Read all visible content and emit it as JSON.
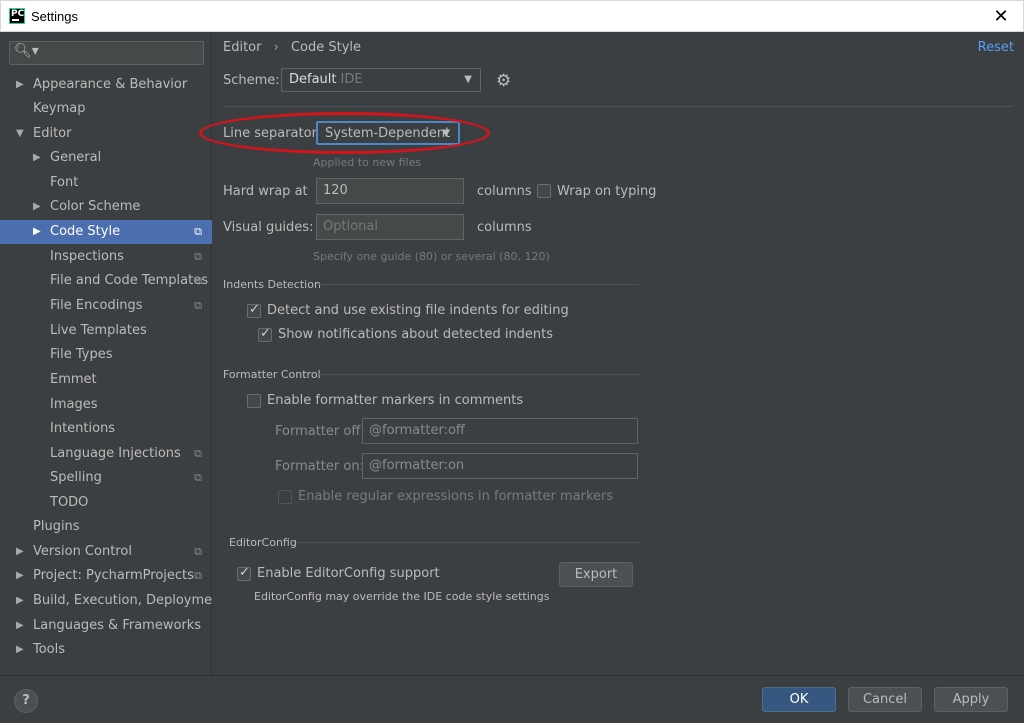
{
  "window": {
    "title": "Settings",
    "close_icon": "✕"
  },
  "sidebar": {
    "search_placeholder": "",
    "items": [
      {
        "label": "Appearance & Behavior"
      },
      {
        "label": "Keymap"
      },
      {
        "label": "Editor"
      },
      {
        "label": "General"
      },
      {
        "label": "Font"
      },
      {
        "label": "Color Scheme"
      },
      {
        "label": "Code Style"
      },
      {
        "label": "Inspections"
      },
      {
        "label": "File and Code Templates"
      },
      {
        "label": "File Encodings"
      },
      {
        "label": "Live Templates"
      },
      {
        "label": "File Types"
      },
      {
        "label": "Emmet"
      },
      {
        "label": "Images"
      },
      {
        "label": "Intentions"
      },
      {
        "label": "Language Injections"
      },
      {
        "label": "Spelling"
      },
      {
        "label": "TODO"
      },
      {
        "label": "Plugins"
      },
      {
        "label": "Version Control"
      },
      {
        "label": "Project: PycharmProjects"
      },
      {
        "label": "Build, Execution, Deployment"
      },
      {
        "label": "Languages & Frameworks"
      },
      {
        "label": "Tools"
      }
    ]
  },
  "header": {
    "breadcrumb_parent": "Editor",
    "breadcrumb_sep": "›",
    "breadcrumb_current": "Code Style",
    "reset": "Reset"
  },
  "scheme": {
    "label": "Scheme:",
    "value": "Default",
    "value_suffix": "IDE"
  },
  "line_separator": {
    "label": "Line separator:",
    "value": "System-Dependent",
    "hint": "Applied to new files"
  },
  "hard_wrap": {
    "label": "Hard wrap at",
    "value": "120",
    "unit": "columns",
    "wrap_on_typing": "Wrap on typing"
  },
  "visual_guides": {
    "label": "Visual guides:",
    "placeholder": "Optional",
    "unit": "columns",
    "hint": "Specify one guide (80) or several (80, 120)"
  },
  "indents": {
    "title": "Indents Detection",
    "detect": "Detect and use existing file indents for editing",
    "notify": "Show notifications about detected indents"
  },
  "formatter": {
    "title": "Formatter Control",
    "enable": "Enable formatter markers in comments",
    "off_label": "Formatter off:",
    "off_value": "@formatter:off",
    "on_label": "Formatter on:",
    "on_value": "@formatter:on",
    "regex": "Enable regular expressions in formatter markers"
  },
  "editorconfig": {
    "title": "EditorConfig",
    "enable": "Enable EditorConfig support",
    "export": "Export",
    "note": "EditorConfig may override the IDE code style settings"
  },
  "footer": {
    "help": "?",
    "ok": "OK",
    "cancel": "Cancel",
    "apply": "Apply"
  }
}
